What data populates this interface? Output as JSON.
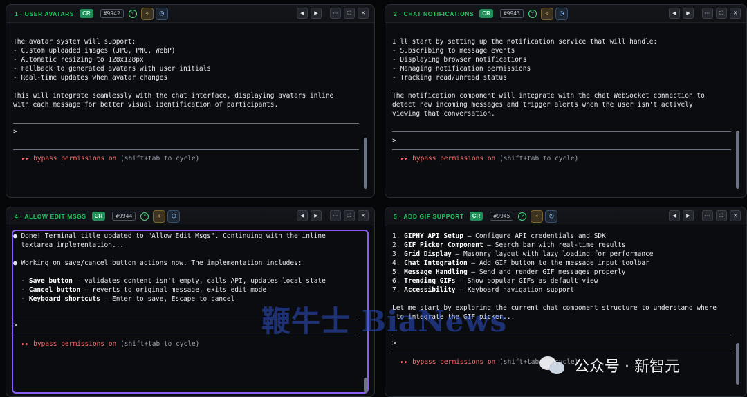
{
  "panes": [
    {
      "title": "1 · USER AVATARS",
      "badge": "CR",
      "number": "#9942",
      "lines": [
        "The avatar system will support:",
        "- Custom uploaded images (JPG, PNG, WebP)",
        "- Automatic resizing to 128x128px",
        "- Fallback to generated avatars with user initials",
        "- Real-time updates when avatar changes",
        "",
        "This will integrate seamlessly with the chat interface, displaying avatars inline",
        "with each message for better visual identification of participants."
      ],
      "prompt": ">",
      "bypass": "bypass permissions on",
      "hint": "(shift+tab to cycle)"
    },
    {
      "title": "2 · CHAT NOTIFICATIONS",
      "badge": "CR",
      "number": "#9943",
      "lines": [
        "I'll start by setting up the notification service that will handle:",
        "- Subscribing to message events",
        "- Displaying browser notifications",
        "- Managing notification permissions",
        "- Tracking read/unread status",
        "",
        "The notification component will integrate with the chat WebSocket connection to",
        "detect new incoming messages and trigger alerts when the user isn't actively",
        "viewing that conversation."
      ],
      "prompt": ">",
      "bypass": "bypass permissions on",
      "hint": "(shift+tab to cycle)"
    },
    {
      "title": "4 · ALLOW EDIT MSGS",
      "badge": "CR",
      "number": "#9944",
      "lines": [
        "● Done! Terminal title updated to \"Allow Edit Msgs\". Continuing with the inline",
        "  textarea implementation...",
        "",
        "● Working on save/cancel button actions now. The implementation includes:",
        "",
        "  - **Save button** – validates content isn't empty, calls API, updates local state",
        "  - **Cancel button** – reverts to original message, exits edit mode",
        "  - **Keyboard shortcuts** – Enter to save, Escape to cancel"
      ],
      "prompt": ">",
      "bypass": "bypass permissions on",
      "hint": "(shift+tab to cycle)"
    },
    {
      "title": "5 · ADD GIF SUPPORT",
      "badge": "CR",
      "number": "#9945",
      "lines": [
        "1. **GIPHY API Setup** – Configure API credentials and SDK",
        "2. **GIF Picker Component** – Search bar with real-time results",
        "3. **Grid Display** – Masonry layout with lazy loading for performance",
        "4. **Chat Integration** – Add GIF button to the message input toolbar",
        "5. **Message Handling** – Send and render GIF messages properly",
        "6. **Trending GIFs** – Show popular GIFs as default view",
        "7. **Accessibility** – Keyboard navigation support",
        "",
        "Let me start by exploring the current chat component structure to understand where",
        " to integrate the GIF picker..."
      ],
      "prompt": ">",
      "bypass": "bypass permissions on",
      "hint": "(shift+tab to cycle)"
    }
  ],
  "watermark": "鞭牛士 BiaNews",
  "wechat_label": "公众号 · 新智元"
}
